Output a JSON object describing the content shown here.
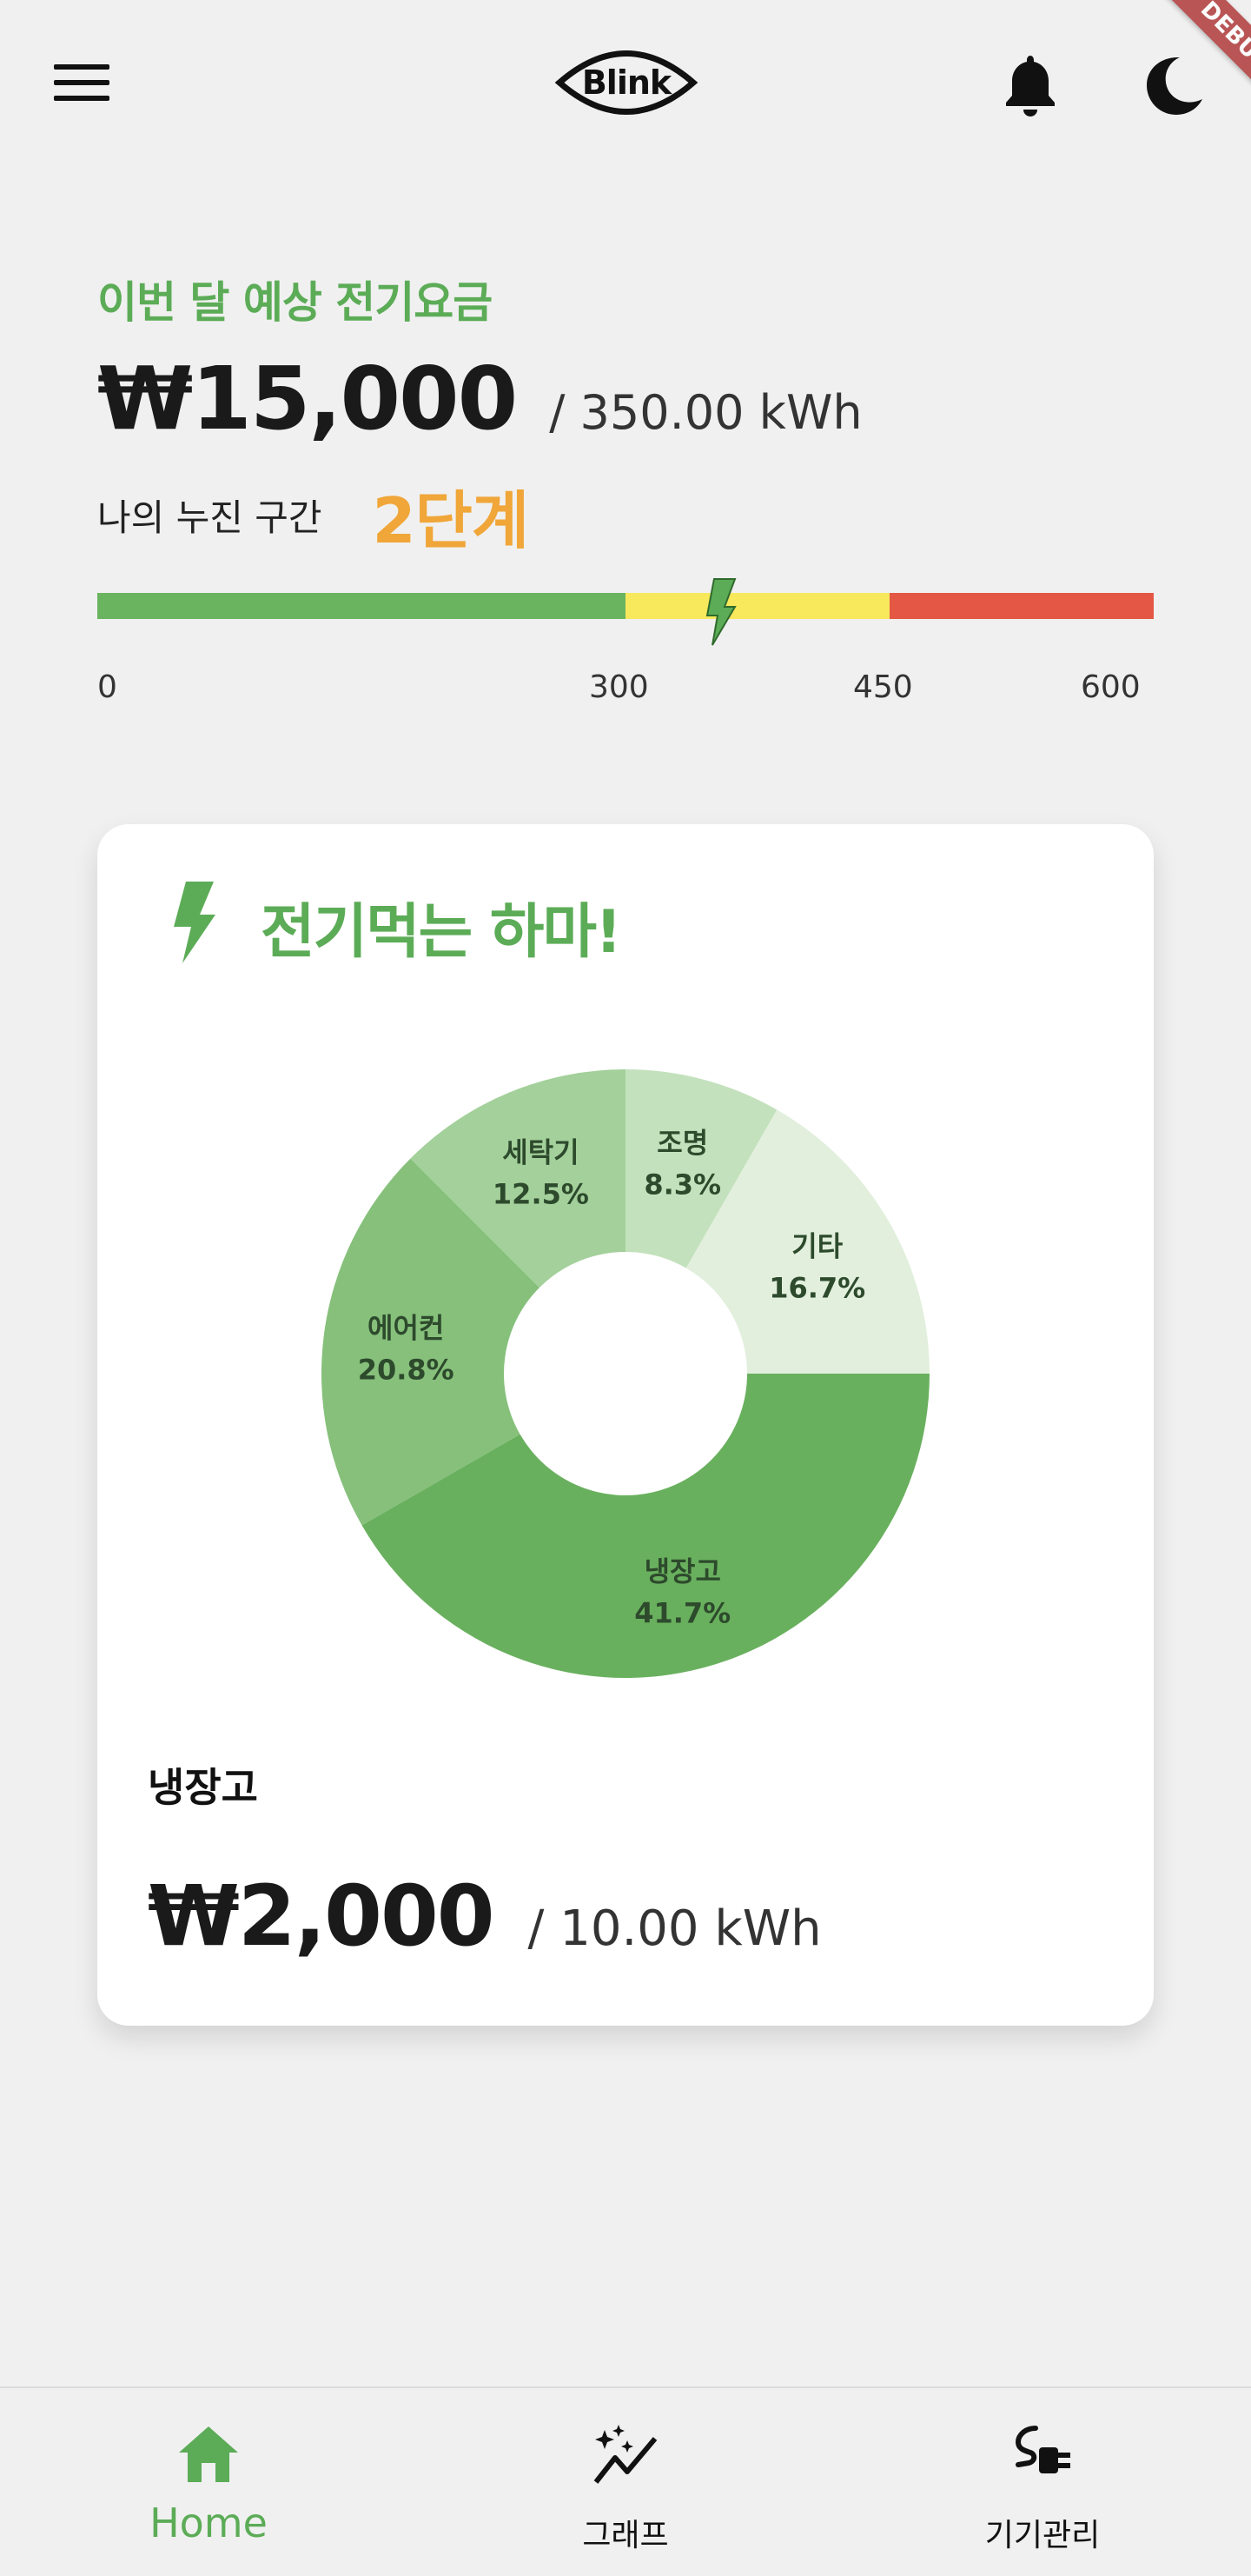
{
  "app": {
    "logo_text": "Blink",
    "debug_banner": "DEBUG"
  },
  "summary": {
    "label": "이번 달 예상 전기요금",
    "amount": "₩15,000",
    "kwh": "/ 350.00 kWh",
    "tier_label": "나의 누진 구간",
    "tier_value": "2단계",
    "tier_progress_kwh": 350,
    "ticks": [
      "0",
      "300",
      "450",
      "600"
    ],
    "colors": {
      "low": "#6ab45f",
      "mid": "#f8e85c",
      "high": "#e35744",
      "accent": "#5cac57",
      "tier": "#f0a638"
    }
  },
  "card": {
    "title": "전기먹는 하마!",
    "icon": "lightning-icon",
    "chart_data": {
      "type": "pie",
      "categories": [
        "냉장고",
        "에어컨",
        "세탁기",
        "조명",
        "기타"
      ],
      "values": [
        41.7,
        20.8,
        12.5,
        8.3,
        16.7
      ],
      "labels": [
        "41.7%",
        "20.8%",
        "12.5%",
        "8.3%",
        "16.7%"
      ],
      "colors": [
        "#69b05e",
        "#86c07b",
        "#a4d09b",
        "#c4e1bd",
        "#e1efdc"
      ]
    },
    "selected": {
      "name": "냉장고",
      "amount": "₩2,000",
      "kwh": "/ 10.00 kWh"
    }
  },
  "nav": {
    "items": [
      {
        "label": "Home",
        "icon": "home-icon",
        "active": true
      },
      {
        "label": "그래프",
        "icon": "graph-icon",
        "active": false
      },
      {
        "label": "기기관리",
        "icon": "plug-icon",
        "active": false
      }
    ],
    "active_color": "#5cac57"
  }
}
